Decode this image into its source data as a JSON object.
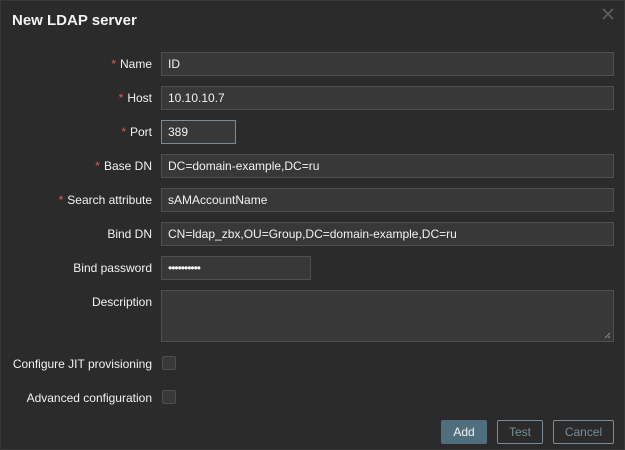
{
  "dialog": {
    "title": "New LDAP server",
    "close_icon": "close-icon"
  },
  "fields": {
    "name": {
      "label": "Name",
      "required": "*",
      "value": "ID"
    },
    "host": {
      "label": "Host",
      "required": "*",
      "value": "10.10.10.7"
    },
    "port": {
      "label": "Port",
      "required": "*",
      "value": "389"
    },
    "base_dn": {
      "label": "Base DN",
      "required": "*",
      "value": "DC=domain-example,DC=ru"
    },
    "search_attribute": {
      "label": "Search attribute",
      "required": "*",
      "value": "sAMAccountName"
    },
    "bind_dn": {
      "label": "Bind DN",
      "value": "CN=ldap_zbx,OU=Group,DC=domain-example,DC=ru"
    },
    "bind_password": {
      "label": "Bind password",
      "value": "••••••••••"
    },
    "description": {
      "label": "Description",
      "value": ""
    },
    "jit": {
      "label": "Configure JIT provisioning",
      "checked": false
    },
    "advanced": {
      "label": "Advanced configuration",
      "checked": false
    }
  },
  "buttons": {
    "add": "Add",
    "test": "Test",
    "cancel": "Cancel"
  },
  "colors": {
    "required": "#e45959",
    "primary": "#4f6f7f",
    "accent": "#768d99",
    "background": "#2b2b2b"
  }
}
